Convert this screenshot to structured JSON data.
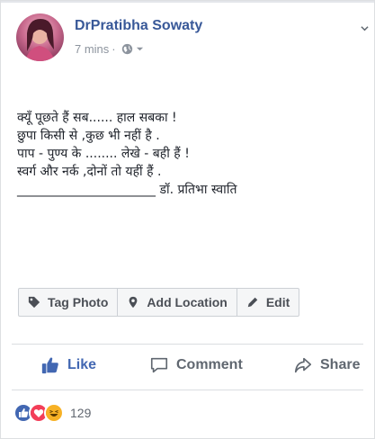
{
  "post": {
    "author": "DrPratibha Sowaty",
    "time": "7 mins",
    "separator": "·",
    "lines": [
      "क्यूँ पूछते हैं सब...... हाल सबका !",
      "छुपा किसी से ,कुछ भी नहीं है .",
      "पाप - पुण्य के ........ लेखे - बही हैं !",
      "स्वर्ग और नर्क ,दोनों तो यहीं हैं .",
      "______________________ डॉ. प्रतिभा स्वाति"
    ]
  },
  "tag_bar": {
    "tag_photo": "Tag Photo",
    "add_location": "Add Location",
    "edit": "Edit"
  },
  "actions": {
    "like": "Like",
    "comment": "Comment",
    "share": "Share"
  },
  "reactions": {
    "count": "129",
    "types": [
      "like",
      "love",
      "haha"
    ]
  },
  "colors": {
    "author": "#385898",
    "like_active": "#4267b2",
    "love": "#f33e58",
    "haha": "#f7b125"
  }
}
